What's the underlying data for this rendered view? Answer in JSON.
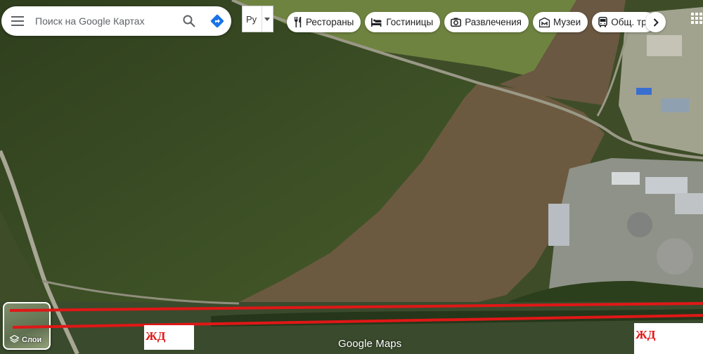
{
  "search": {
    "placeholder": "Поиск на Google Картах"
  },
  "language_selector": {
    "label": "Ру"
  },
  "categories": [
    {
      "label": "Рестораны",
      "icon": "fork-knife-icon"
    },
    {
      "label": "Гостиницы",
      "icon": "bed-icon"
    },
    {
      "label": "Развлечения",
      "icon": "camera-icon"
    },
    {
      "label": "Музеи",
      "icon": "museum-icon"
    },
    {
      "label": "Общ. транспорт",
      "icon": "bus-icon"
    }
  ],
  "layers": {
    "label": "Слои"
  },
  "annotations": {
    "railway_left": "ЖД",
    "railway_right": "ЖД",
    "line_color": "#e01717"
  },
  "logo": "Google Maps"
}
